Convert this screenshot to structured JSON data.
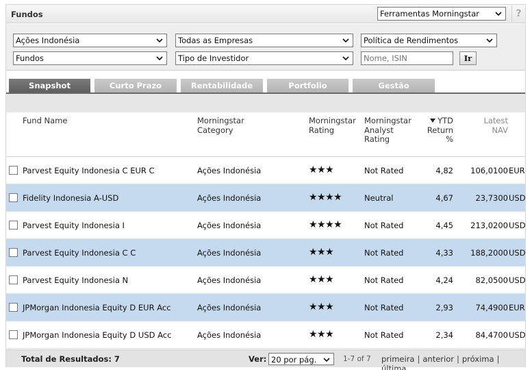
{
  "header": {
    "title": "Fundos",
    "tools_selected": "Ferramentas Morningstar",
    "help_label": "?"
  },
  "filters": {
    "category": "Ações Indonésia",
    "companies": "Todas as Empresas",
    "income_policy": "Política de Rendimentos",
    "universe": "Fundos",
    "investor_type": "Tipo de Investidor",
    "search_placeholder": "Nome, ISIN",
    "go_label": "Ir"
  },
  "tabs": [
    {
      "label": "Snapshot",
      "active": true
    },
    {
      "label": "Curto Prazo",
      "active": false
    },
    {
      "label": "Rentabilidade",
      "active": false
    },
    {
      "label": "Portfolio",
      "active": false
    },
    {
      "label": "Gestão",
      "active": false
    }
  ],
  "table": {
    "columns": {
      "fund_name": "Fund Name",
      "category": [
        "Morningstar",
        "Category"
      ],
      "rating": [
        "Morningstar",
        "Rating"
      ],
      "analyst_rating": [
        "Morningstar",
        "Analyst",
        "Rating"
      ],
      "ytd": [
        "YTD",
        "Return",
        "%"
      ],
      "nav": [
        "Latest",
        "NAV"
      ]
    },
    "rows": [
      {
        "name": "Parvest Equity Indonesia C EUR C",
        "category": "Ações Indonésia",
        "stars": "★★★",
        "analyst": "Not Rated",
        "ytd": "4,82",
        "nav": "106,0100",
        "currency": "EUR"
      },
      {
        "name": "Fidelity Indonesia A-USD",
        "category": "Ações Indonésia",
        "stars": "★★★★",
        "analyst": "Neutral",
        "ytd": "4,67",
        "nav": "23,7300",
        "currency": "USD"
      },
      {
        "name": "Parvest Equity Indonesia I",
        "category": "Ações Indonésia",
        "stars": "★★★★",
        "analyst": "Not Rated",
        "ytd": "4,45",
        "nav": "213,0200",
        "currency": "USD"
      },
      {
        "name": "Parvest Equity Indonesia C C",
        "category": "Ações Indonésia",
        "stars": "★★★",
        "analyst": "Not Rated",
        "ytd": "4,33",
        "nav": "188,2000",
        "currency": "USD"
      },
      {
        "name": "Parvest Equity Indonesia N",
        "category": "Ações Indonésia",
        "stars": "★★★",
        "analyst": "Not Rated",
        "ytd": "4,24",
        "nav": "82,0500",
        "currency": "USD"
      },
      {
        "name": "JPMorgan Indonesia Equity D EUR Acc",
        "category": "Ações Indonésia",
        "stars": "★★★",
        "analyst": "Not Rated",
        "ytd": "2,93",
        "nav": "74,4900",
        "currency": "EUR"
      },
      {
        "name": "JPMorgan Indonesia Equity D USD Acc",
        "category": "Ações Indonésia",
        "stars": "★★★",
        "analyst": "Not Rated",
        "ytd": "2,34",
        "nav": "84,4700",
        "currency": "USD"
      }
    ]
  },
  "footer": {
    "total_label": "Total de Resultados: 7",
    "ver_label": "Ver:",
    "per_page": "20 por pág.",
    "range": "1-7 of 7",
    "first": "primeira",
    "prev": "anterior",
    "next": "próxima",
    "last": "última",
    "separator": "|"
  },
  "colors": {
    "row_alt": "#c6daef",
    "tab_active": "#6a6a6a",
    "tab_inactive": "#bdbdbd"
  }
}
